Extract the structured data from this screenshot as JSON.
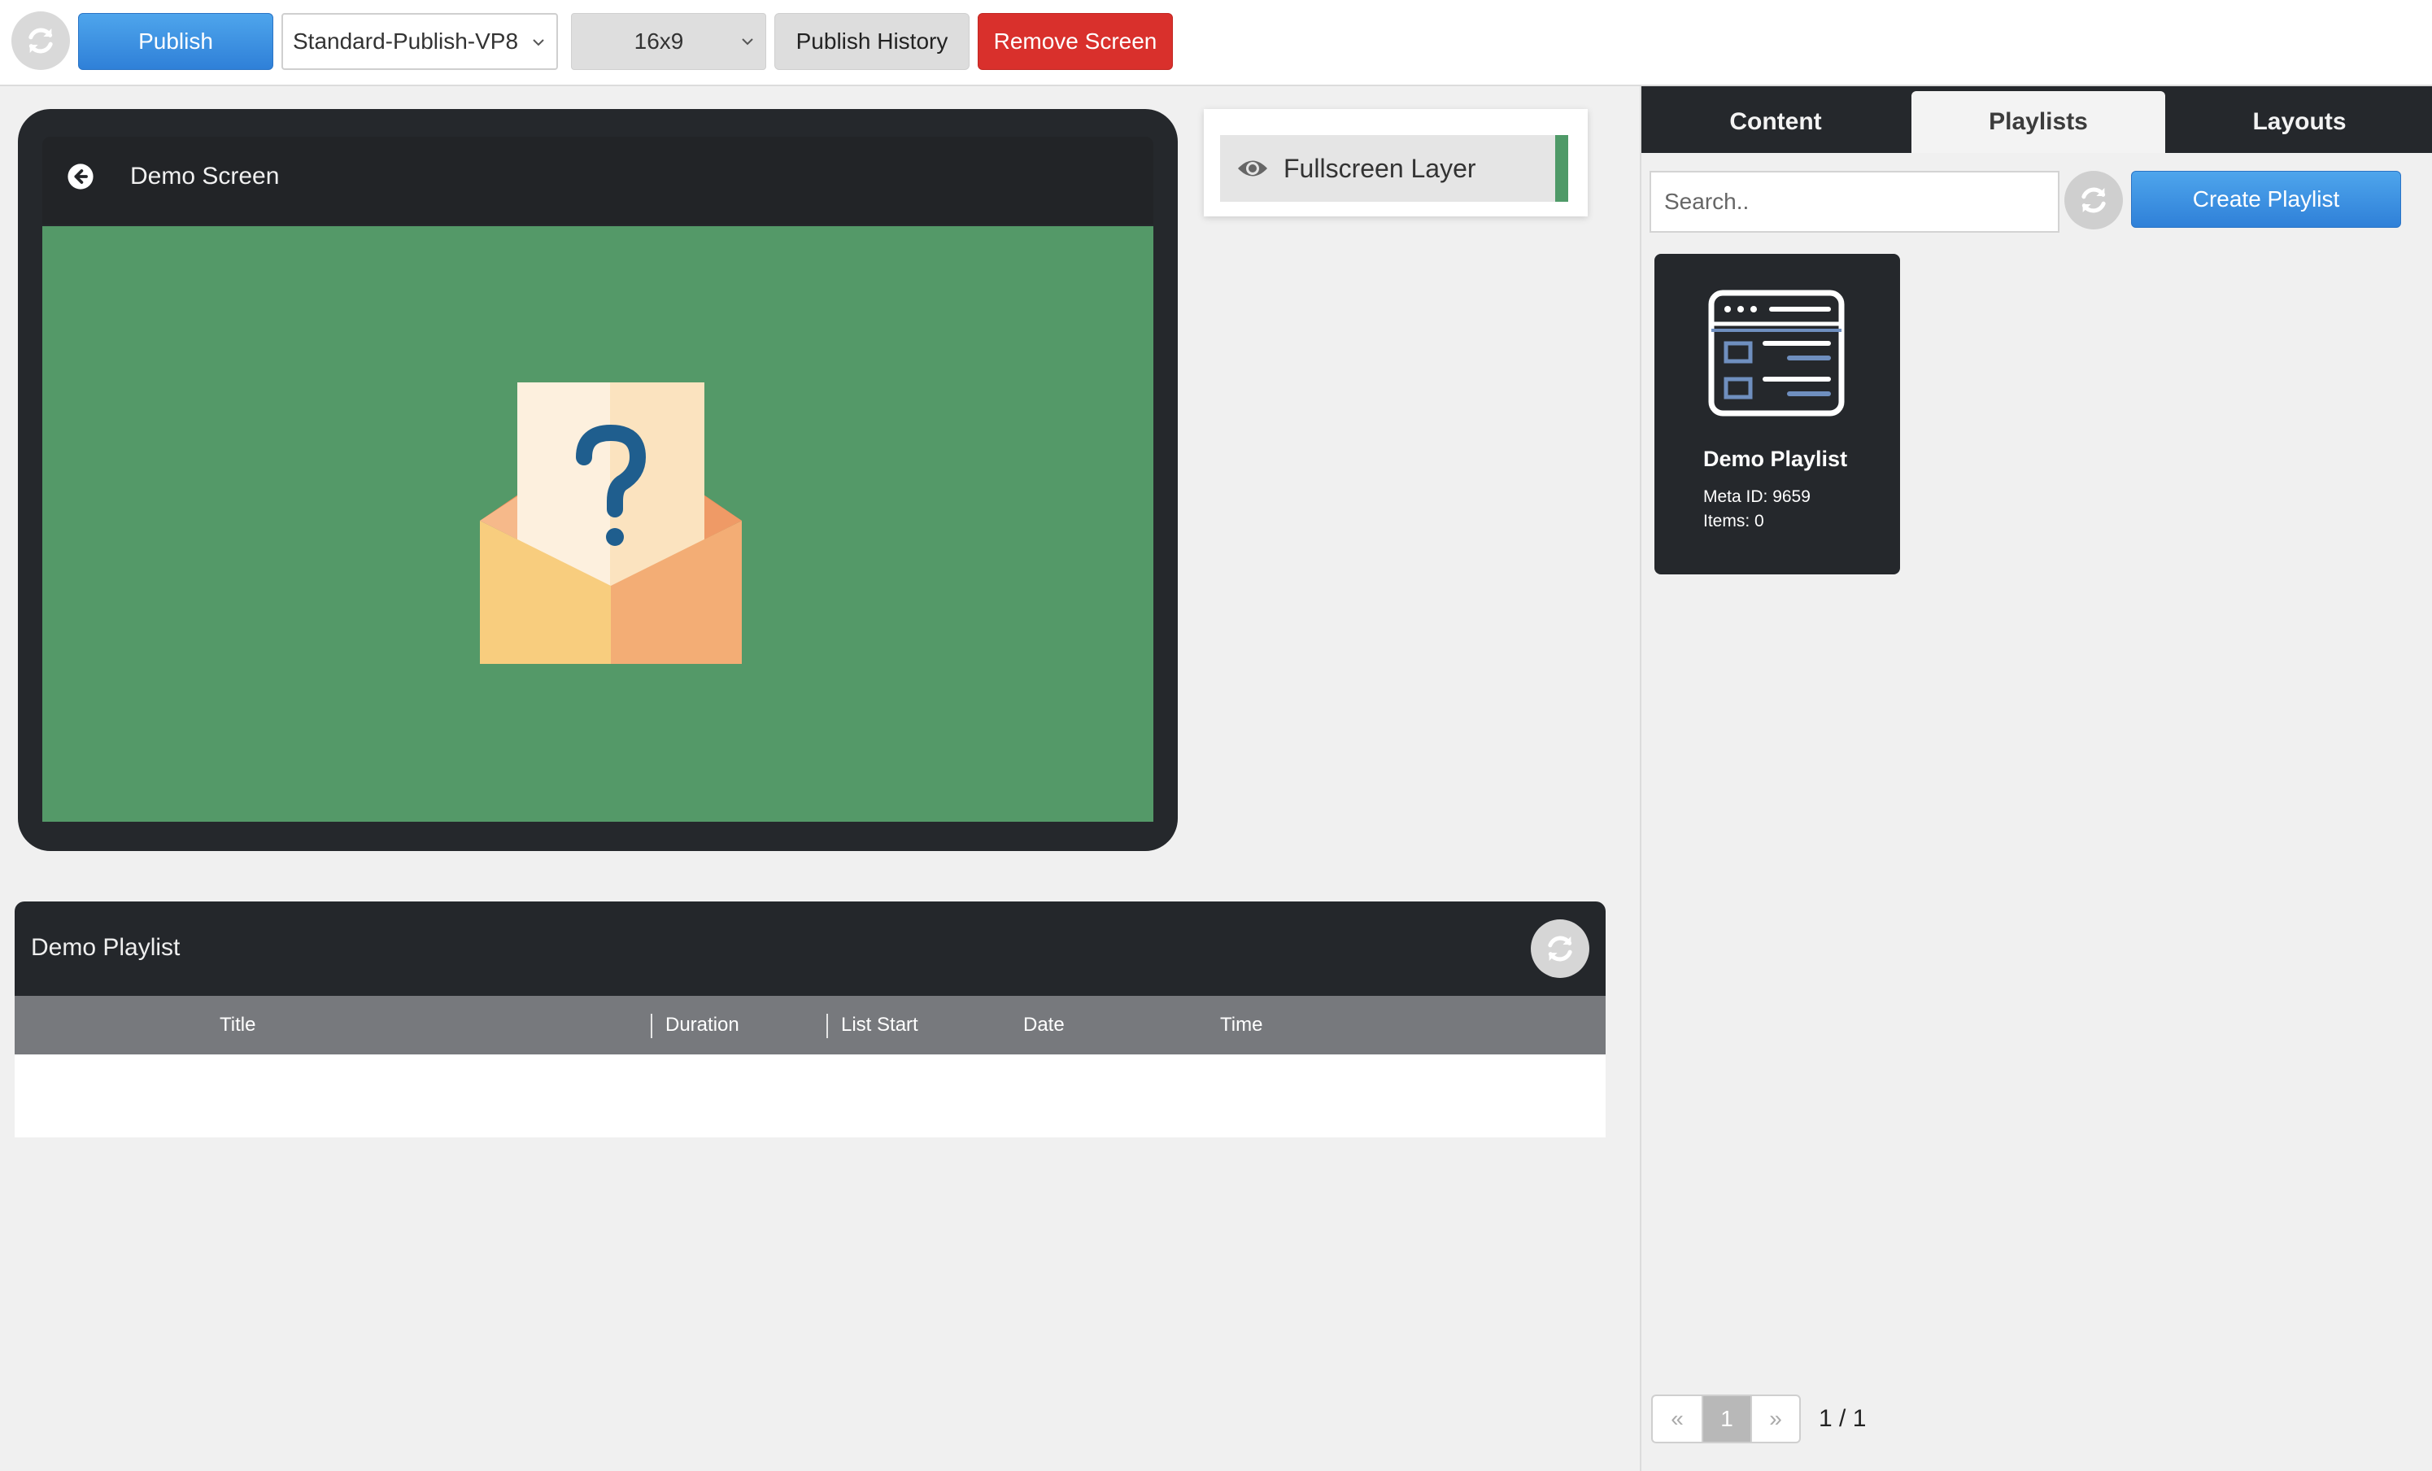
{
  "toolbar": {
    "refresh_icon": "refresh-icon",
    "publish_label": "Publish",
    "profile_value": "Standard-Publish-VP8",
    "ratio_value": "16x9",
    "history_label": "Publish History",
    "remove_label": "Remove Screen"
  },
  "preview": {
    "screen_title": "Demo Screen",
    "back_icon": "arrow-left-circle-icon",
    "canvas_color": "#549968",
    "placeholder_icon": "envelope-question-icon"
  },
  "layers": {
    "items": [
      {
        "label": "Fullscreen Layer",
        "icon": "eye-icon",
        "color": "#4f9a68"
      }
    ]
  },
  "playlist_table": {
    "title": "Demo Playlist",
    "columns": [
      "Title",
      "Duration",
      "List Start",
      "Date",
      "Time"
    ],
    "rows": []
  },
  "sidebar": {
    "tabs": [
      {
        "label": "Content",
        "active": false
      },
      {
        "label": "Playlists",
        "active": true
      },
      {
        "label": "Layouts",
        "active": false
      }
    ],
    "search": {
      "placeholder": "Search..",
      "value": ""
    },
    "create_label": "Create Playlist",
    "cards": [
      {
        "name": "Demo Playlist",
        "meta": "Meta ID: 9659",
        "items": "Items: 0",
        "icon": "playlist-window-icon"
      }
    ],
    "pagination": {
      "prev": "«",
      "current": "1",
      "next": "»",
      "summary": "1 / 1"
    }
  },
  "colors": {
    "primary_blue": "#2f80d8",
    "danger_red": "#d9302c",
    "dark_panel": "#25282c",
    "accent_green": "#4f9a68"
  }
}
